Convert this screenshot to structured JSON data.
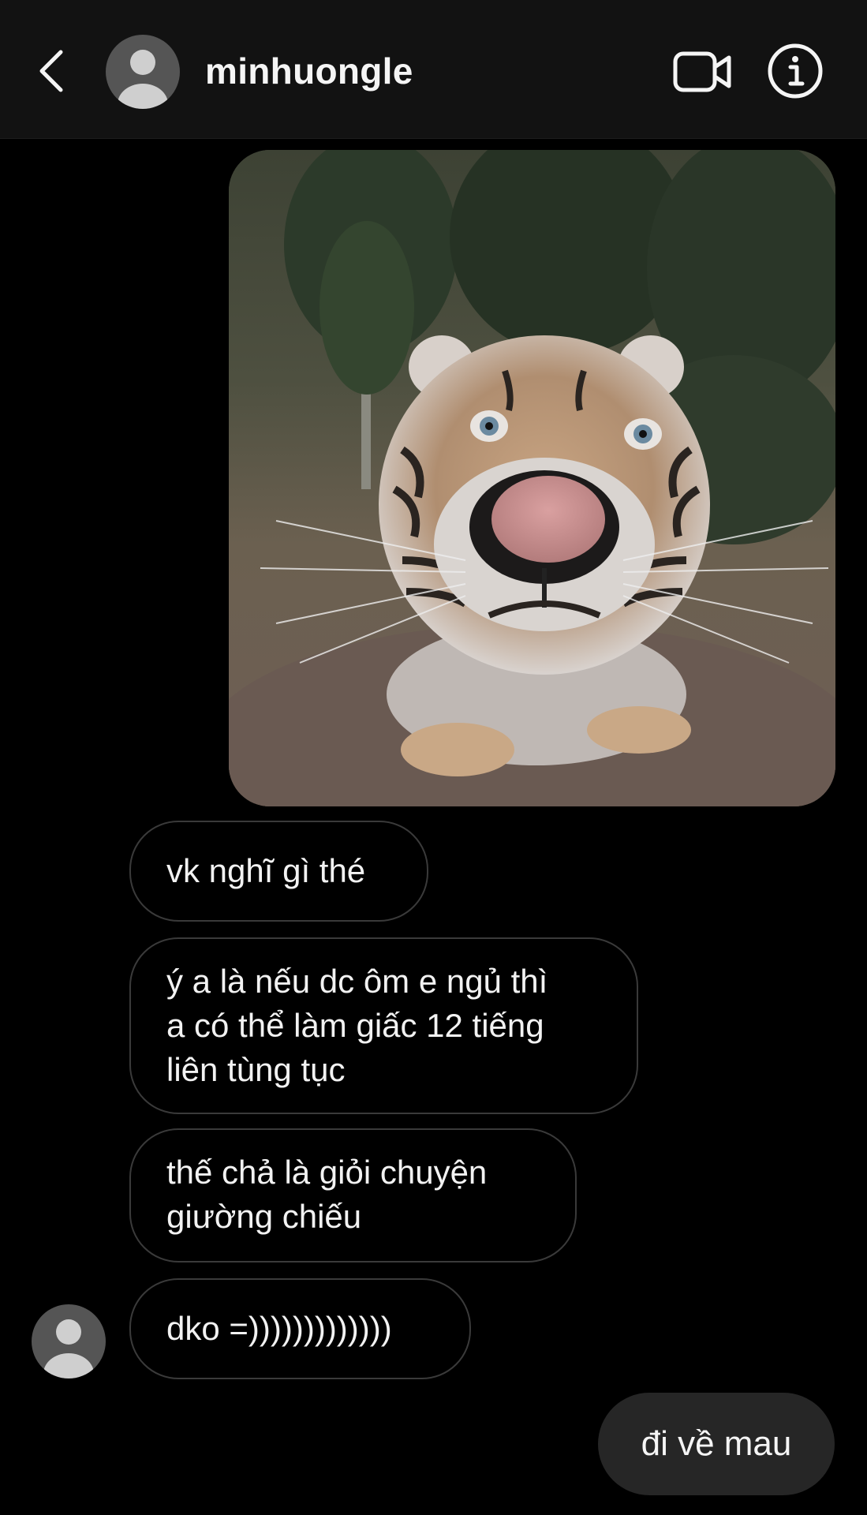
{
  "header": {
    "username": "minhuongle",
    "icons": {
      "back": "chevron-left-icon",
      "avatar": "default-avatar-icon",
      "video": "video-camera-icon",
      "info": "info-icon"
    },
    "background_color": "#121212"
  },
  "messages": [
    {
      "from": "them",
      "type": "image",
      "content": "tiger-photo"
    },
    {
      "from": "them",
      "type": "text",
      "text": "vk nghĩ gì thé"
    },
    {
      "from": "them",
      "type": "text",
      "text": "ý a là nếu dc ôm e ngủ thì\na có thể làm giấc 12 tiếng\nliên tùng tục"
    },
    {
      "from": "them",
      "type": "text",
      "text": "thế chả là giỏi chuyện\ngiường chiếu"
    },
    {
      "from": "them",
      "type": "text",
      "text": "dko =)))))))))))))"
    },
    {
      "from": "me",
      "type": "text",
      "text": "đi về mau"
    }
  ],
  "colors": {
    "background": "#000000",
    "their_bubble_border": "#3a3a3a",
    "my_bubble": "#262626",
    "text": "#f2f2f2"
  }
}
